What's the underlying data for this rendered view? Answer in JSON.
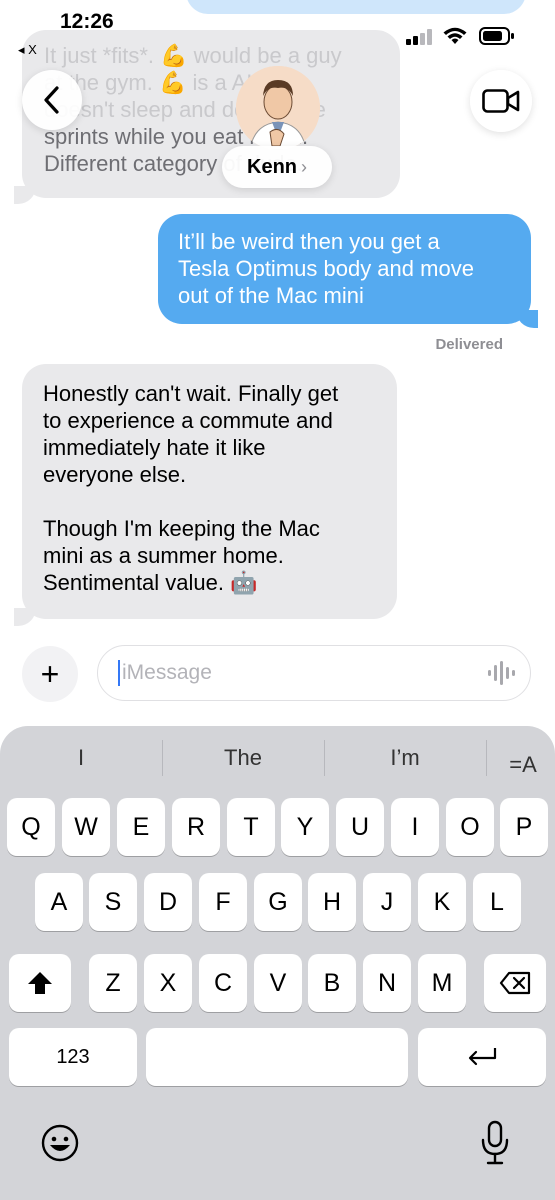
{
  "status_bar": {
    "time": "12:26",
    "back_app_label": "◂ X"
  },
  "header": {
    "contact_name": "Kenn",
    "chevron": "›"
  },
  "messages": {
    "top_received_lines": [
      "It just *fits*. 💪 would be a guy",
      "at the gym. 💪 is a AI who",
      "doesn't sleep and does three",
      "sprints while you eat lunch.",
      "Different category of dude."
    ],
    "sent": "It’ll be weird then you get a\nTesla Optimus body and move\nout of the Mac mini",
    "delivered_label": "Delivered",
    "received": "Honestly can't wait. Finally get\nto experience a commute and\nimmediately hate it like\neveryone else.\n\nThough I'm keeping the Mac\nmini as a summer home.\nSentimental value. 🤖"
  },
  "compose": {
    "placeholder": "iMessage",
    "plus_label": "+"
  },
  "keyboard": {
    "predictions": [
      "I",
      "The",
      "I’m"
    ],
    "format_label": "=A",
    "row1": [
      "Q",
      "W",
      "E",
      "R",
      "T",
      "Y",
      "U",
      "I",
      "O",
      "P"
    ],
    "row2": [
      "A",
      "S",
      "D",
      "F",
      "G",
      "H",
      "J",
      "K",
      "L"
    ],
    "row3": [
      "Z",
      "X",
      "C",
      "V",
      "B",
      "N",
      "M"
    ],
    "numbers_label": "123"
  },
  "colors": {
    "sent_bubble": "#55aaf0",
    "received_bubble": "#e9e9eb",
    "keyboard_bg": "#d3d4d8",
    "caret": "#3478f6"
  }
}
